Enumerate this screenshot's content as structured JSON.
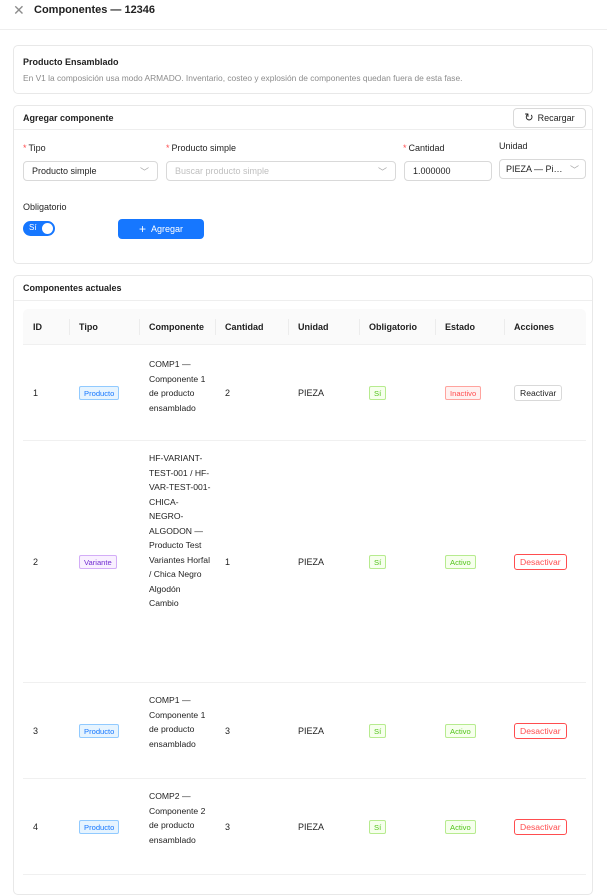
{
  "header": {
    "title": "Componentes — 12346"
  },
  "info": {
    "title": "Producto Ensamblado",
    "description": "En V1 la composición usa modo ARMADO. Inventario, costeo y explosión de componentes quedan fuera de esta fase."
  },
  "form": {
    "title": "Agregar componente",
    "reload_label": "Recargar",
    "tipo_label": "Tipo",
    "tipo_value": "Producto simple",
    "producto_label": "Producto simple",
    "producto_placeholder": "Buscar producto simple",
    "cantidad_label": "Cantidad",
    "cantidad_value": "1.000000",
    "unidad_label": "Unidad",
    "unidad_value": "PIEZA — Pie...",
    "obligatorio_label": "Obligatorio",
    "obligatorio_switch": "Sí",
    "add_label": "Agregar",
    "required_mark": "*"
  },
  "table": {
    "title": "Componentes actuales",
    "columns": [
      "ID",
      "Tipo",
      "Componente",
      "Cantidad",
      "Unidad",
      "Obligatorio",
      "Estado",
      "Acciones"
    ],
    "rows": [
      {
        "id": "1",
        "tipo": "Producto",
        "componente": "COMP1 — Componente 1 de producto ensamblado",
        "cantidad": "2",
        "unidad": "PIEZA",
        "obligatorio": "Sí",
        "estado": "Inactivo",
        "accion": "Reactivar"
      },
      {
        "id": "2",
        "tipo": "Variante",
        "componente": "HF-VARIANT-TEST-001 / HF-VAR-TEST-001-CHICA-NEGRO-ALGODON — Producto Test Variantes Horfal / Chica Negro Algodón Cambio",
        "cantidad": "1",
        "unidad": "PIEZA",
        "obligatorio": "Sí",
        "estado": "Activo",
        "accion": "Desactivar"
      },
      {
        "id": "3",
        "tipo": "Producto",
        "componente": "COMP1 — Componente 1 de producto ensamblado",
        "cantidad": "3",
        "unidad": "PIEZA",
        "obligatorio": "Sí",
        "estado": "Activo",
        "accion": "Desactivar"
      },
      {
        "id": "4",
        "tipo": "Producto",
        "componente": "COMP2 — Componente 2 de producto ensamblado",
        "cantidad": "3",
        "unidad": "PIEZA",
        "obligatorio": "Sí",
        "estado": "Activo",
        "accion": "Desactivar"
      }
    ]
  },
  "colors": {
    "primary": "#1677ff",
    "danger": "#ff4d4f",
    "success": "#52c41a",
    "purple": "#722ed1"
  },
  "icons": {
    "close": "close-icon",
    "reload": "reload-icon",
    "plus": "plus-icon",
    "chevron": "chevron-down-icon"
  }
}
